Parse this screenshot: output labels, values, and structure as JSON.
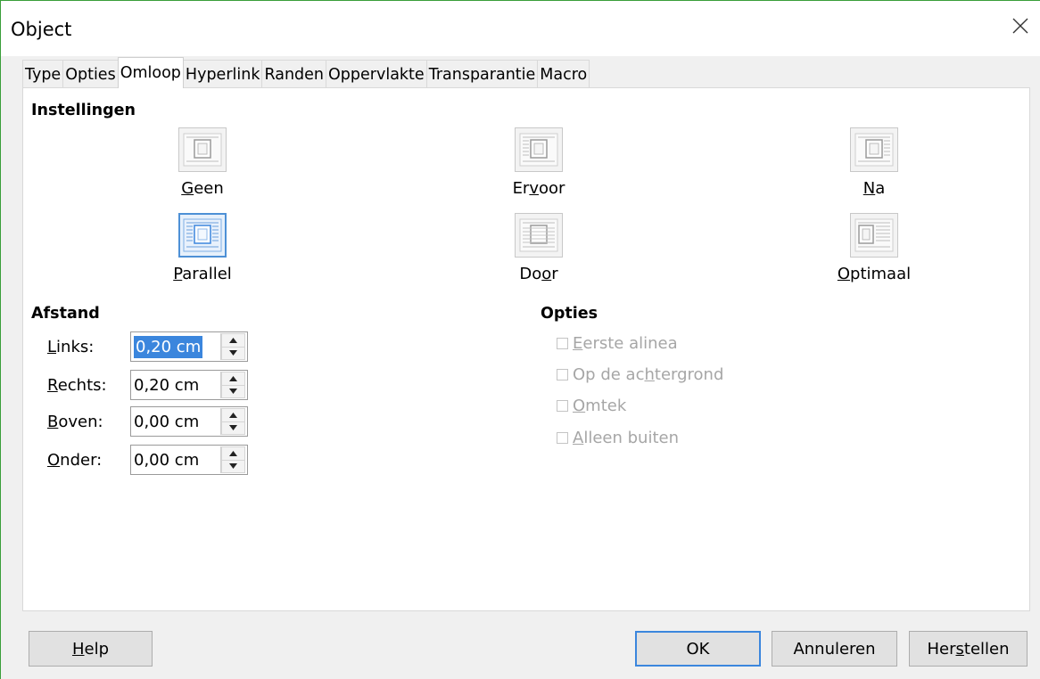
{
  "window": {
    "title": "Object"
  },
  "tabs": [
    {
      "label": "Type",
      "active": false
    },
    {
      "label": "Opties",
      "active": false
    },
    {
      "label": "Omloop",
      "active": true
    },
    {
      "label": "Hyperlink",
      "active": false
    },
    {
      "label": "Randen",
      "active": false
    },
    {
      "label": "Oppervlakte",
      "active": false
    },
    {
      "label": "Transparantie",
      "active": false
    },
    {
      "label": "Macro",
      "active": false
    }
  ],
  "settings": {
    "title": "Instellingen",
    "options": [
      {
        "label_pre": "",
        "label_key": "G",
        "label_post": "een",
        "selected": false,
        "icon": "wrap-none-icon"
      },
      {
        "label_pre": "Er",
        "label_key": "v",
        "label_post": "oor",
        "selected": false,
        "icon": "wrap-before-icon"
      },
      {
        "label_pre": "",
        "label_key": "N",
        "label_post": "a",
        "selected": false,
        "icon": "wrap-after-icon"
      },
      {
        "label_pre": "",
        "label_key": "P",
        "label_post": "arallel",
        "selected": true,
        "icon": "wrap-parallel-icon"
      },
      {
        "label_pre": "Do",
        "label_key": "o",
        "label_post": "r",
        "selected": false,
        "icon": "wrap-through-icon"
      },
      {
        "label_pre": "",
        "label_key": "O",
        "label_post": "ptimaal",
        "selected": false,
        "icon": "wrap-optimal-icon"
      }
    ]
  },
  "spacing": {
    "title": "Afstand",
    "fields": [
      {
        "label_key": "L",
        "label_post": "inks:",
        "value": "0,20 cm",
        "selected": true
      },
      {
        "label_key": "R",
        "label_post": "echts:",
        "value": "0,20 cm",
        "selected": false
      },
      {
        "label_key": "B",
        "label_post": "oven:",
        "value": "0,00 cm",
        "selected": false
      },
      {
        "label_key": "O",
        "label_post": "nder:",
        "value": "0,00 cm",
        "selected": false
      }
    ]
  },
  "options": {
    "title": "Opties",
    "items": [
      {
        "label_pre": "",
        "label_key": "E",
        "label_post": "erste alinea",
        "checked": false,
        "enabled": false
      },
      {
        "label_pre": "Op de ac",
        "label_key": "h",
        "label_post": "tergrond",
        "checked": false,
        "enabled": false
      },
      {
        "label_pre": "",
        "label_key": "O",
        "label_post": "mtek",
        "checked": false,
        "enabled": false
      },
      {
        "label_pre": "",
        "label_key": "A",
        "label_post": "lleen buiten",
        "checked": false,
        "enabled": false
      }
    ]
  },
  "buttons": {
    "help": {
      "label_key": "H",
      "label_post": "elp"
    },
    "ok": {
      "label": "OK"
    },
    "cancel": {
      "label": "Annuleren"
    },
    "reset": {
      "label_pre": "Her",
      "label_key": "s",
      "label_post": "tellen"
    }
  },
  "colors": {
    "accent": "#3b86dd",
    "selection": "#3b86dd",
    "disabled_text": "#a6a6a6"
  }
}
